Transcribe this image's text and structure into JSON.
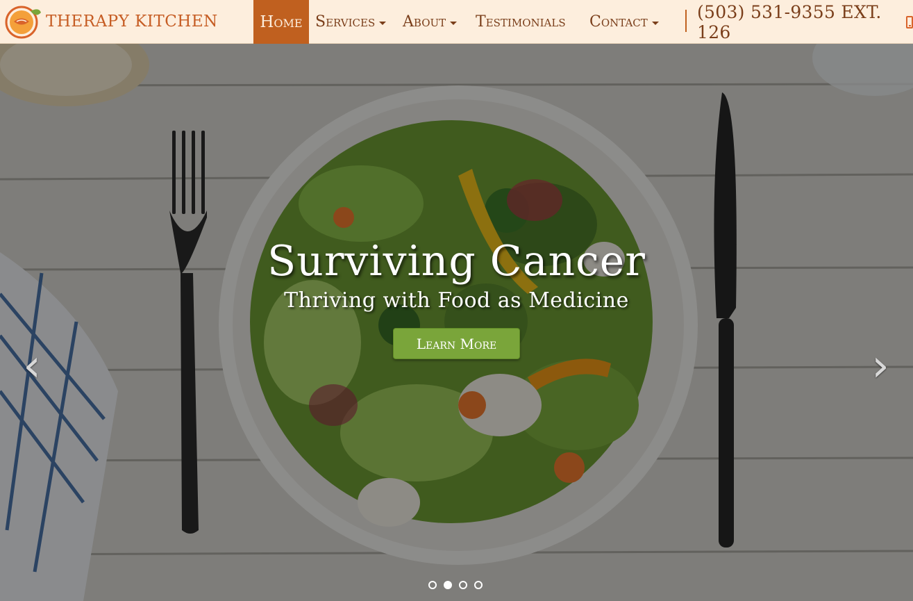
{
  "brand": {
    "name": "Therapy Kitchen",
    "logo_icon": "orange-leaf-logo-icon"
  },
  "nav": {
    "home": "Home",
    "services": "Services",
    "about": "About",
    "testimonials": "Testimonials",
    "contact": "Contact",
    "phone": "(503) 531-9355 EXT. 126",
    "phone_icon": "mobile-phone-icon"
  },
  "hero": {
    "title": "Surviving Cancer",
    "subtitle": "Thriving with Food as Medicine",
    "cta": "Learn More",
    "prev_icon": "chevron-left-icon",
    "next_icon": "chevron-right-icon",
    "slide_count": 4,
    "active_slide": 2
  },
  "colors": {
    "nav_bg": "#fdeedd",
    "accent": "#c0601f",
    "text_brown": "#7a3e1a",
    "cta_green": "#7aa53a"
  }
}
